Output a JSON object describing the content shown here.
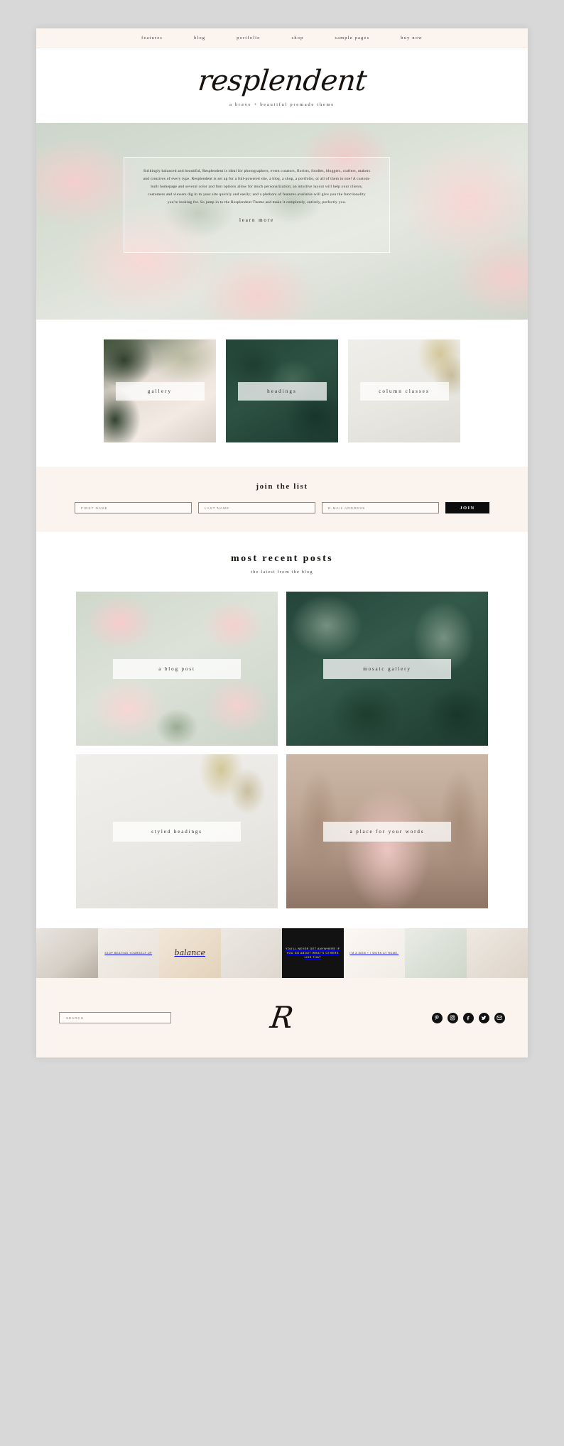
{
  "nav": {
    "items": [
      {
        "label": "features"
      },
      {
        "label": "blog"
      },
      {
        "label": "portfolio"
      },
      {
        "label": "shop"
      },
      {
        "label": "sample pages"
      },
      {
        "label": "buy now"
      }
    ]
  },
  "branding": {
    "logo": "resplendent",
    "tagline": "a brave + beautiful premade theme",
    "monogram": "R"
  },
  "hero": {
    "paragraph": "Strikingly balanced and beautiful, Resplendent is ideal for photographers, event curators, florists, foodies, bloggers, crafters, makers and creatives of every type. Resplendent is set up for a full-powered site, a blog, a shop, a portfolio, or all of them in one! A custom-built homepage and several color and font options allow for much personalization; an intuitive layout will help your clients, customers and viewers dig in to your site quickly and easily; and a plethora of features available will give you the functionality you're looking for. So jump in to the Resplendent Theme and make it completely, entirely, perfectly you.",
    "cta": "learn more"
  },
  "features": {
    "items": [
      {
        "label": "gallery"
      },
      {
        "label": "headings"
      },
      {
        "label": "column classes"
      }
    ]
  },
  "newsletter": {
    "title": "join the list",
    "first_name_placeholder": "FIRST NAME",
    "last_name_placeholder": "LAST NAME",
    "email_placeholder": "E-MAIL ADDRESS",
    "first_name_value": "",
    "last_name_value": "",
    "email_value": "",
    "submit_label": "JOIN"
  },
  "blog": {
    "title": "most recent posts",
    "subtitle": "the latest from the blog",
    "posts": [
      {
        "label": "a blog post"
      },
      {
        "label": "mosaic gallery"
      },
      {
        "label": "styled headings"
      },
      {
        "label": "a place for your words"
      }
    ]
  },
  "instagram": {
    "cells": [
      {
        "text": ""
      },
      {
        "text": "STOP BEATING YOURSELF UP"
      },
      {
        "text": "balance"
      },
      {
        "text": ""
      },
      {
        "text": "YOU'LL NEVER GET ANYWHERE IF YOU GO ABOUT WHAT'S OTHERS LIKE THAT"
      },
      {
        "text": "I'M A MOM + I WORK AT HOME."
      },
      {
        "text": ""
      },
      {
        "text": ""
      }
    ]
  },
  "footer": {
    "search_placeholder": "SEARCH",
    "search_value": "",
    "socials": [
      {
        "name": "pinterest",
        "glyph": "P"
      },
      {
        "name": "instagram",
        "glyph": "◉"
      },
      {
        "name": "facebook",
        "glyph": "f"
      },
      {
        "name": "twitter",
        "glyph": "t"
      },
      {
        "name": "email",
        "glyph": "✉"
      }
    ]
  },
  "colors": {
    "cream": "#fbf3ee",
    "ink": "#111111",
    "page_bg": "#d8d8d8"
  }
}
